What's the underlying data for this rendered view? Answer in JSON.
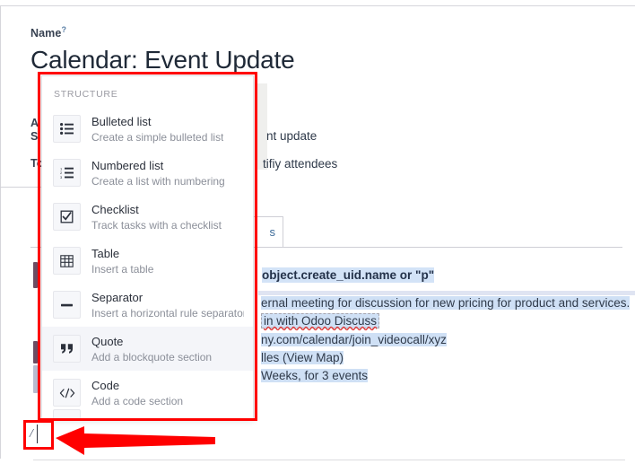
{
  "form": {
    "name_label": "Name",
    "name_help_marker": "?",
    "title": "Calendar: Event Update",
    "field_labels": [
      {
        "short": "A",
        "full": "Applies to"
      },
      {
        "short": "S",
        "full": "Subject"
      },
      {
        "short": "To",
        "full": "To"
      }
    ],
    "field_values": [
      "nt update",
      "tifiy attendees"
    ],
    "tab_label": "s"
  },
  "body": {
    "code_expression": "object.create_uid.name or \"p\"",
    "lines": [
      "ernal meeting for discussion for new pricing for product and services.",
      "in with Odoo Discuss",
      "ny.com/calendar/join_videocall/xyz",
      "lles (View Map)",
      "Weeks, for 3 events"
    ],
    "slash_command": "/"
  },
  "powerbox": {
    "category": "STRUCTURE",
    "items": [
      {
        "icon": "bulleted-list-icon",
        "title": "Bulleted list",
        "desc": "Create a simple bulleted list",
        "active": false
      },
      {
        "icon": "numbered-list-icon",
        "title": "Numbered list",
        "desc": "Create a list with numbering",
        "active": false
      },
      {
        "icon": "checklist-icon",
        "title": "Checklist",
        "desc": "Track tasks with a checklist",
        "active": false
      },
      {
        "icon": "table-icon",
        "title": "Table",
        "desc": "Insert a table",
        "active": false
      },
      {
        "icon": "separator-icon",
        "title": "Separator",
        "desc": "Insert a horizontal rule separator",
        "active": false
      },
      {
        "icon": "quote-icon",
        "title": "Quote",
        "desc": "Add a blockquote section",
        "active": true
      },
      {
        "icon": "code-icon",
        "title": "Code",
        "desc": "Add a code section",
        "active": false
      }
    ]
  },
  "annotations": {
    "highlight_color": "#ff0000",
    "menu_box_label": "powerbox-highlight",
    "slash_box_label": "slash-trigger-highlight",
    "arrow_label": "pointer-arrow"
  },
  "colors": {
    "selection": "#cfe0f5",
    "selection_soft": "#dfe4f2",
    "accent": "#6d4d63",
    "link": "#3d6b99",
    "annotation": "#ff0000"
  }
}
